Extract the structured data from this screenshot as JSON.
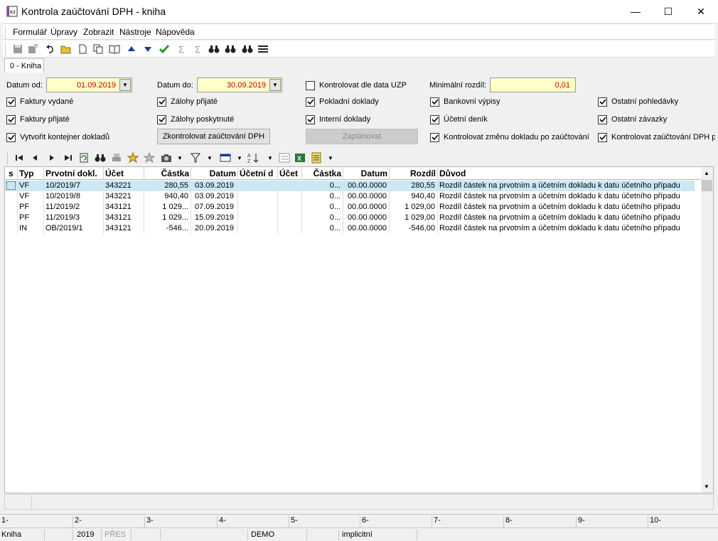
{
  "window": {
    "title": "Kontrola zaúčtování DPH - kniha",
    "minimize": "—",
    "maximize": "☐",
    "close": "✕"
  },
  "menu": [
    "Formulář",
    "Úpravy",
    "Zobrazit",
    "Nástroje",
    "Nápověda"
  ],
  "tabs": [
    "0 - Kniha"
  ],
  "form": {
    "datum_od_label": "Datum od:",
    "datum_od_value": "01.09.2019",
    "datum_do_label": "Datum do:",
    "datum_do_value": "30.09.2019",
    "uzp_label": "Kontrolovat dle data UZP",
    "min_rozdil_label": "Minimální rozdíl:",
    "min_rozdil_value": "0,01",
    "checks": {
      "faktury_vydane": "Faktury vydané",
      "faktury_prijate": "Faktury přijaté",
      "vytvorit_kontejner": "Vytvořit kontejner dokladů",
      "zalohy_prijate": "Zálohy přijaté",
      "zalohy_poskytnute": "Zálohy poskytnuté",
      "pokladni_doklady": "Pokladní doklady",
      "interni_doklady": "Interní doklady",
      "bankovni_vypisy": "Bankovní výpisy",
      "ucetni_denik": "Účetní deník",
      "kontrolovat_zmenu": "Kontrolovat změnu dokladu po zaúčtování",
      "ostatni_pohledavky": "Ostatní pohledávky",
      "ostatni_zavazky": "Ostatní závazky",
      "kontrolovat_zauctovani": "Kontrolovat zaúčtování DPH při"
    },
    "btn_zkontrolovat": "Zkontrolovat zaúčtování DPH",
    "btn_zaplanovat": "Zaplánovat"
  },
  "grid": {
    "columns": [
      "s",
      "Typ",
      "Prvotní dokl.",
      "Účet",
      "Částka",
      "Datum",
      "Účetní d",
      "Účet",
      "Částka",
      "Datum",
      "Rozdíl",
      "Důvod"
    ],
    "rows": [
      [
        "",
        "VF",
        "10/2019/7",
        "343221",
        "280,55",
        "03.09.2019",
        "",
        "",
        "0...",
        "00.00.0000",
        "280,55",
        "Rozdíl částek na prvotním a účetním dokladu k datu účetního případu"
      ],
      [
        "",
        "VF",
        "10/2019/8",
        "343221",
        "940,40",
        "03.09.2019",
        "",
        "",
        "0...",
        "00.00.0000",
        "940,40",
        "Rozdíl částek na prvotním a účetním dokladu k datu účetního případu"
      ],
      [
        "",
        "PF",
        "11/2019/2",
        "343121",
        "1 029...",
        "07.09.2019",
        "",
        "",
        "0...",
        "00.00.0000",
        "1 029,00",
        "Rozdíl částek na prvotním a účetním dokladu k datu účetního případu"
      ],
      [
        "",
        "PF",
        "11/2019/3",
        "343121",
        "1 029...",
        "15.09.2019",
        "",
        "",
        "0...",
        "00.00.0000",
        "1 029,00",
        "Rozdíl částek na prvotním a účetním dokladu k datu účetního případu"
      ],
      [
        "",
        "IN",
        "OB/2019/1",
        "343121",
        "-546...",
        "20.09.2019",
        "",
        "",
        "0...",
        "00.00.0000",
        "-546,00",
        "Rozdíl částek na prvotním a účetním dokladu k datu účetního případu"
      ]
    ]
  },
  "function_keys": [
    "1-",
    "2-",
    "3-",
    "4-",
    "5-",
    "6-",
    "7-",
    "8-",
    "9-",
    "10-"
  ],
  "status": {
    "module": "Kniha",
    "year": "2019",
    "mode": "PŘES",
    "db": "DEMO",
    "profile": "implicitní"
  },
  "colors": {
    "required_field_bg": "#ffffc8",
    "date_text": "#c00000",
    "selected_row": "#cce8f4"
  }
}
